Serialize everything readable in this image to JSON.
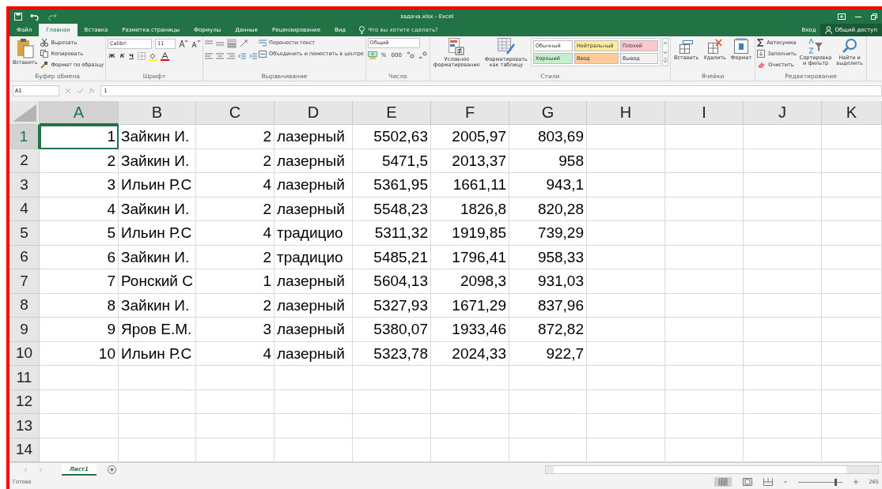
{
  "window": {
    "title": "задача.xlsx - Excel"
  },
  "ribbon_tabs": [
    {
      "label": "Файл",
      "selected": false
    },
    {
      "label": "Главная",
      "selected": true
    },
    {
      "label": "Вставка",
      "selected": false
    },
    {
      "label": "Разметка страницы",
      "selected": false
    },
    {
      "label": "Формулы",
      "selected": false
    },
    {
      "label": "Данные",
      "selected": false
    },
    {
      "label": "Рецензирование",
      "selected": false
    },
    {
      "label": "Вид",
      "selected": false
    }
  ],
  "tell_me": {
    "placeholder": "Что вы хотите сделать?"
  },
  "account": {
    "sign_in": "Вход",
    "share": "Общий доступ"
  },
  "clipboard": {
    "paste": "Вставить",
    "cut": "Вырезать",
    "copy": "Копировать",
    "format_painter": "Формат по образцу",
    "label": "Буфер обмена"
  },
  "font": {
    "family": "Calibri",
    "size": "11",
    "bold": "Ж",
    "italic": "К",
    "underline": "Ч",
    "label": "Шрифт"
  },
  "alignment": {
    "wrap": "Перенести текст",
    "merge": "Объединить и поместить в центре",
    "label": "Выравнивание"
  },
  "number": {
    "format": "Общий",
    "percent": "%",
    "thousands": "000",
    "label": "Число"
  },
  "styles": {
    "conditional": "Условное форматирование",
    "as_table": "Форматировать как таблицу",
    "label": "Стили",
    "cells": [
      {
        "label": "Обычный",
        "color": "#ffffff"
      },
      {
        "label": "Нейтральный",
        "color": "#ffeb9c"
      },
      {
        "label": "Плохой",
        "color": "#ffc7ce"
      },
      {
        "label": "Хороший",
        "color": "#c6efce"
      },
      {
        "label": "Ввод",
        "color": "#ffcc99"
      },
      {
        "label": "Вывод",
        "color": "#f2f2f2"
      }
    ]
  },
  "cells_group": {
    "insert": "Вставить",
    "delete": "Удалить",
    "format": "Формат",
    "label": "Ячейки"
  },
  "editing": {
    "autosum": "Автосумма",
    "fill": "Заполнить",
    "clear": "Очистить",
    "sort": "Сортировка и фильтр",
    "find": "Найти и выделить",
    "label": "Редактирование"
  },
  "formula_bar": {
    "name_box": "A1",
    "fx": "fx",
    "value": "1"
  },
  "columns": [
    {
      "label": "A",
      "kind": "number",
      "selected": true
    },
    {
      "label": "B",
      "kind": "text",
      "selected": false
    },
    {
      "label": "C",
      "kind": "number",
      "selected": false
    },
    {
      "label": "D",
      "kind": "text",
      "selected": false
    },
    {
      "label": "E",
      "kind": "number",
      "selected": false
    },
    {
      "label": "F",
      "kind": "number",
      "selected": false
    },
    {
      "label": "G",
      "kind": "number",
      "selected": false
    },
    {
      "label": "H",
      "kind": "text",
      "selected": false
    },
    {
      "label": "I",
      "kind": "text",
      "selected": false
    },
    {
      "label": "J",
      "kind": "text",
      "selected": false
    },
    {
      "label": "K",
      "kind": "text",
      "selected": false
    }
  ],
  "rows": [
    {
      "header": "1",
      "selected": true,
      "cells": [
        "1",
        "Зайкин И.",
        "2",
        "лазерный",
        "5502,63",
        "2005,97",
        "803,69"
      ]
    },
    {
      "header": "2",
      "selected": false,
      "cells": [
        "2",
        "Зайкин И.",
        "2",
        "лазерный",
        "5471,5",
        "2013,37",
        "958"
      ]
    },
    {
      "header": "3",
      "selected": false,
      "cells": [
        "3",
        "Ильин Р.С",
        "4",
        "лазерный",
        "5361,95",
        "1661,11",
        "943,1"
      ]
    },
    {
      "header": "4",
      "selected": false,
      "cells": [
        "4",
        "Зайкин И.",
        "2",
        "лазерный",
        "5548,23",
        "1826,8",
        "820,28"
      ]
    },
    {
      "header": "5",
      "selected": false,
      "cells": [
        "5",
        "Ильин Р.С",
        "4",
        "традицио",
        "5311,32",
        "1919,85",
        "739,29"
      ]
    },
    {
      "header": "6",
      "selected": false,
      "cells": [
        "6",
        "Зайкин И.",
        "2",
        "традицио",
        "5485,21",
        "1796,41",
        "958,33"
      ]
    },
    {
      "header": "7",
      "selected": false,
      "cells": [
        "7",
        "Ронский С",
        "1",
        "лазерный",
        "5604,13",
        "2098,3",
        "931,03"
      ]
    },
    {
      "header": "8",
      "selected": false,
      "cells": [
        "8",
        "Зайкин И.",
        "2",
        "лазерный",
        "5327,93",
        "1671,29",
        "837,96"
      ]
    },
    {
      "header": "9",
      "selected": false,
      "cells": [
        "9",
        "Яров Е.М.",
        "3",
        "лазерный",
        "5380,07",
        "1933,46",
        "872,82"
      ]
    },
    {
      "header": "10",
      "selected": false,
      "cells": [
        "10",
        "Ильин Р.С",
        "4",
        "лазерный",
        "5323,78",
        "2024,33",
        "922,7"
      ]
    },
    {
      "header": "11",
      "selected": false,
      "cells": []
    },
    {
      "header": "12",
      "selected": false,
      "cells": []
    },
    {
      "header": "13",
      "selected": false,
      "cells": []
    },
    {
      "header": "14",
      "selected": false,
      "cells": []
    }
  ],
  "sheet_tabs": [
    {
      "label": "Лист1",
      "selected": true
    }
  ],
  "status_bar": {
    "status": "Готово",
    "zoom": "265"
  },
  "zoom_slider": {
    "level": 0.85
  }
}
